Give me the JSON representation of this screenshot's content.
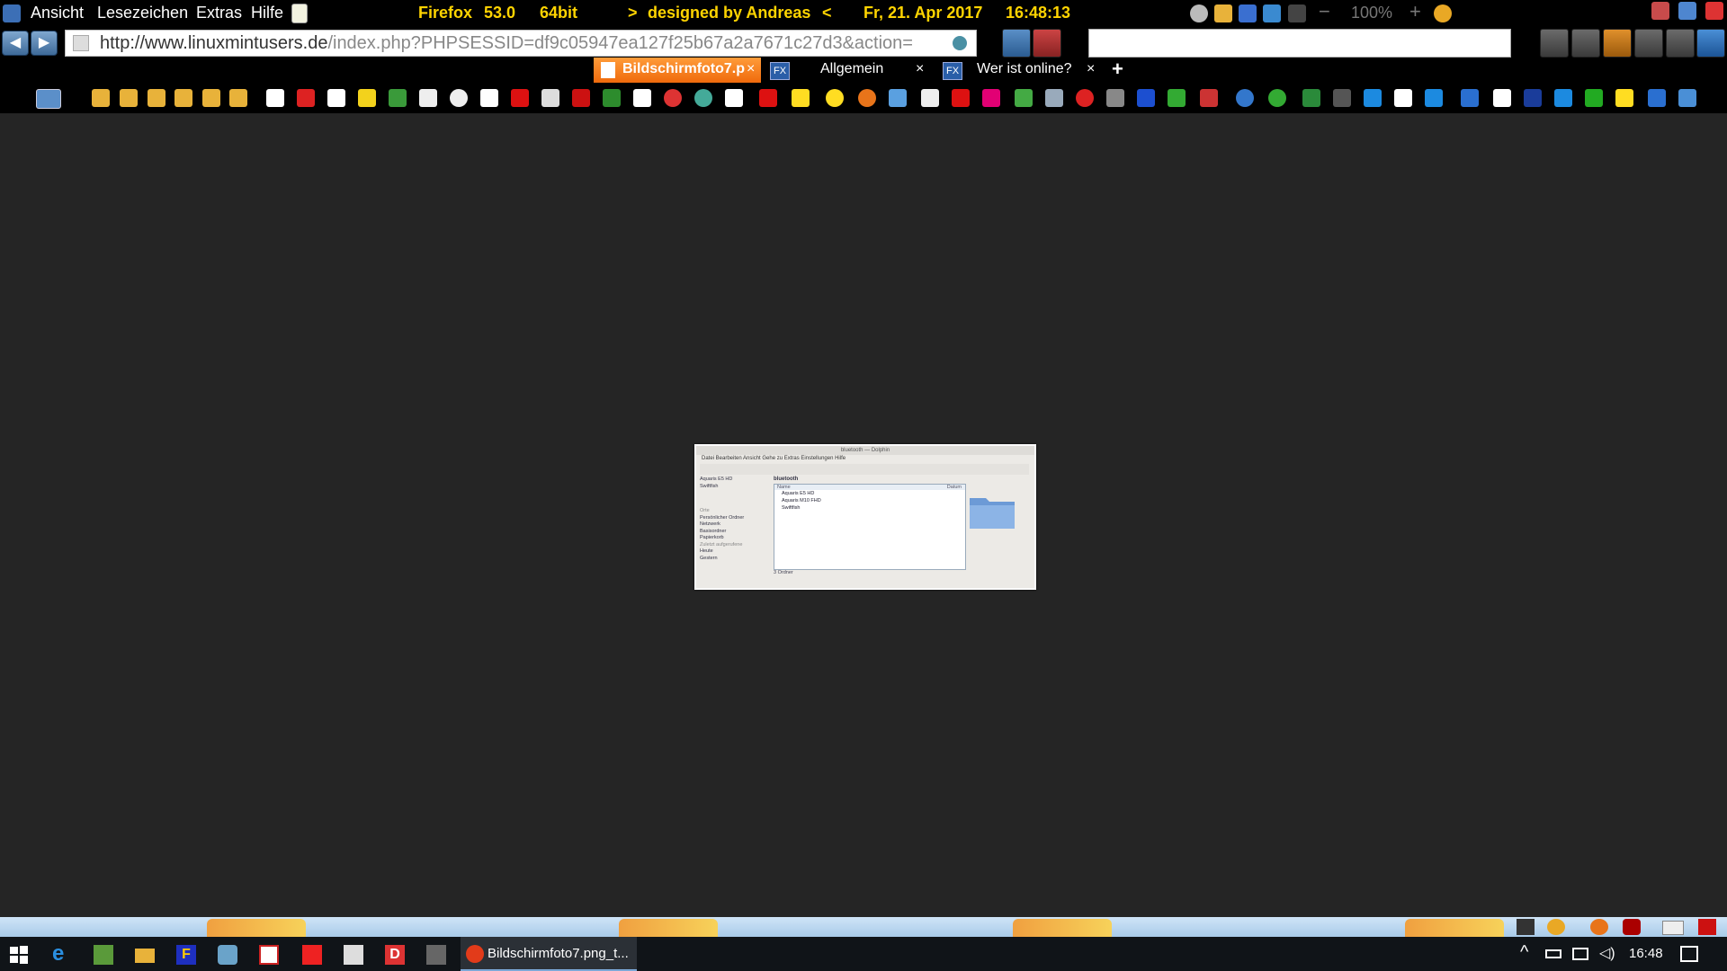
{
  "menubar": {
    "items": [
      "Ansicht",
      "Lesezeichen",
      "Extras",
      "Hilfe"
    ],
    "browser": "Firefox",
    "version": "53.0",
    "arch": "64bit",
    "designer_left": ">",
    "designer": "designed by Andreas",
    "designer_right": "<",
    "date": "Fr, 21. Apr 2017",
    "time": "16:48:13",
    "zoom": "100%"
  },
  "navbar": {
    "url_domain": "http://www.linuxmintusers.de",
    "url_path": "/index.php?PHPSESSID=df9c05947ea127f25b67a2a7671c27d3&action=",
    "search_value": ""
  },
  "tabs": [
    {
      "label": "Bildschirmfoto7.p",
      "active": true
    },
    {
      "label": "Allgemein",
      "active": false
    },
    {
      "label": "Wer ist online?",
      "active": false
    }
  ],
  "tab_close_glyph": "×",
  "new_tab_glyph": "+",
  "screenshot_window": {
    "title": "bluetooth — Dolphin",
    "menu": "Datei  Bearbeiten  Ansicht  Gehe zu  Extras  Einstellungen  Hilfe",
    "location": "bluetooth",
    "columns": [
      "Name",
      "Datum"
    ],
    "rows": [
      "Aquaris E5 HD",
      "Aquaris M10 FHD",
      "Swiftfish"
    ],
    "sidebar": [
      "Aquaris E5 HD",
      "Swiftfish",
      "Orte",
      "Persönlicher Ordner",
      "Netzwerk",
      "Basisordner",
      "Papierkorb",
      "Zuletzt aufgerufene",
      "Heute",
      "Gestern"
    ],
    "status": "3 Ordner"
  },
  "taskbar": {
    "active_task_label": "Bildschirmfoto7.png_t...",
    "clock": "16:48"
  },
  "colors": {
    "accent_yellow": "#ffd400",
    "active_tab": "#ff7b1a",
    "background": "#252525"
  }
}
